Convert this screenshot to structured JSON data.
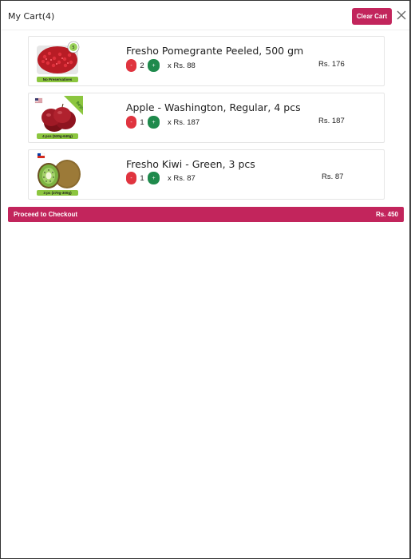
{
  "header": {
    "title": "My Cart(4)",
    "clear_label": "Clear Cart"
  },
  "items": [
    {
      "name": "Fresho Pomegrante Peeled, 500 gm",
      "qty": "2",
      "unit_price": "x Rs. 88",
      "total": "Rs. 176",
      "minus": "-",
      "plus": "+",
      "badge": "No Preservatives"
    },
    {
      "name": "Apple - Washington, Regular, 4 pcs",
      "qty": "1",
      "unit_price": "x Rs. 187",
      "total": "Rs. 187",
      "minus": "-",
      "plus": "+",
      "badge": "4 pcs (530g-640g)",
      "ribbon": "Regular"
    },
    {
      "name": "Fresho Kiwi - Green, 3 pcs",
      "qty": "1",
      "unit_price": "x Rs. 87",
      "total": "Rs. 87",
      "minus": "-",
      "plus": "+",
      "badge": "3 pc (270g-300g)"
    }
  ],
  "checkout": {
    "label": "Proceed to Checkout",
    "total": "Rs. 450"
  },
  "colors": {
    "accent": "#c2255c",
    "minus": "#e0343f",
    "plus": "#1f8a4c"
  }
}
